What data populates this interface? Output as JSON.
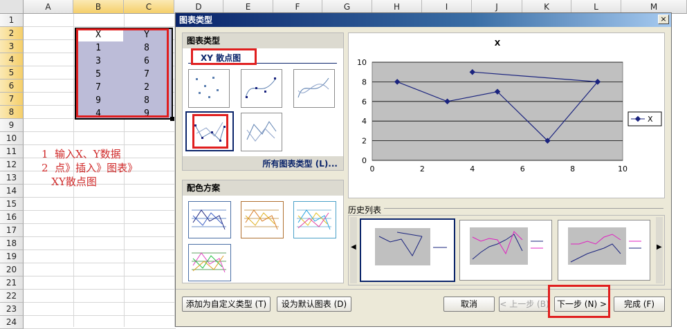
{
  "spreadsheet": {
    "columns": [
      "A",
      "B",
      "C",
      "D",
      "E",
      "F",
      "G",
      "H",
      "I",
      "J",
      "K",
      "L",
      "M"
    ],
    "rows": [
      "1",
      "2",
      "3",
      "4",
      "5",
      "6",
      "7",
      "8",
      "9",
      "10",
      "11",
      "12",
      "13",
      "14",
      "15",
      "16",
      "17",
      "18",
      "19",
      "20",
      "21",
      "22",
      "23",
      "24"
    ],
    "header_row": [
      "X",
      "Y"
    ],
    "data": [
      [
        "1",
        "8"
      ],
      [
        "3",
        "6"
      ],
      [
        "5",
        "7"
      ],
      [
        "7",
        "2"
      ],
      [
        "9",
        "8"
      ],
      [
        "4",
        "9"
      ]
    ],
    "notes": [
      "1  输入X、Y数据",
      "2  点》插入》图表》",
      "   XY散点图"
    ]
  },
  "dialog": {
    "title": "图表类型",
    "close": "×",
    "chart_type_header": "图表类型",
    "selected_type": "XY 散点图",
    "all_types_link": "所有图表类型 (L)...",
    "color_scheme_header": "配色方案",
    "history_label": "历史列表",
    "buttons": {
      "add_custom": "添加为自定义类型 (T)",
      "set_default": "设为默认图表 (D)",
      "cancel": "取消",
      "back": "< 上一步 (B)",
      "next": "下一步 (N) >",
      "finish": "完成 (F)"
    }
  },
  "chart_data": {
    "type": "line",
    "title": "X",
    "series": [
      {
        "name": "X",
        "x": [
          1,
          3,
          5,
          7,
          9,
          4,
          9
        ],
        "y": [
          8,
          6,
          7,
          2,
          8,
          9,
          8
        ]
      }
    ],
    "x_ticks": [
      "0",
      "2",
      "4",
      "6",
      "8",
      "10"
    ],
    "y_ticks": [
      "0",
      "2",
      "4",
      "6",
      "8",
      "10"
    ],
    "xlim": [
      0,
      10
    ],
    "ylim": [
      0,
      10
    ],
    "legend": "right",
    "grid": true,
    "colors": {
      "line": "#1a237e",
      "plot_bg": "#c0c0c0"
    }
  }
}
